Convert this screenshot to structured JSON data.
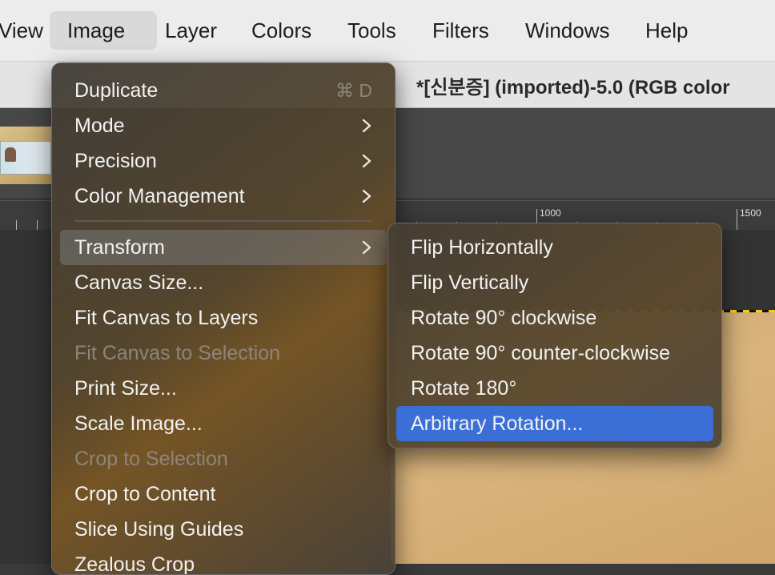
{
  "menubar": {
    "items": [
      {
        "label": "View"
      },
      {
        "label": "Image"
      },
      {
        "label": "Layer"
      },
      {
        "label": "Colors"
      },
      {
        "label": "Tools"
      },
      {
        "label": "Filters"
      },
      {
        "label": "Windows"
      },
      {
        "label": "Help"
      }
    ]
  },
  "window": {
    "title": "*[신분증] (imported)-5.0 (RGB color"
  },
  "ruler": {
    "labels": [
      "1000",
      "1500"
    ]
  },
  "image_menu": {
    "items": [
      {
        "label": "Duplicate",
        "shortcut": "⌘ D"
      },
      {
        "label": "Mode"
      },
      {
        "label": "Precision"
      },
      {
        "label": "Color Management"
      },
      {
        "label": "Transform"
      },
      {
        "label": "Canvas Size..."
      },
      {
        "label": "Fit Canvas to Layers"
      },
      {
        "label": "Fit Canvas to Selection"
      },
      {
        "label": "Print Size..."
      },
      {
        "label": "Scale Image..."
      },
      {
        "label": "Crop to Selection"
      },
      {
        "label": "Crop to Content"
      },
      {
        "label": "Slice Using Guides"
      },
      {
        "label": "Zealous Crop"
      }
    ]
  },
  "transform_menu": {
    "items": [
      {
        "label": "Flip Horizontally"
      },
      {
        "label": "Flip Vertically"
      },
      {
        "label": "Rotate 90° clockwise"
      },
      {
        "label": "Rotate 90° counter-clockwise"
      },
      {
        "label": "Rotate 180°"
      },
      {
        "label": "Arbitrary Rotation..."
      }
    ]
  },
  "colors": {
    "selection": "#3b6fd6",
    "hover": "#6e6e6e"
  }
}
